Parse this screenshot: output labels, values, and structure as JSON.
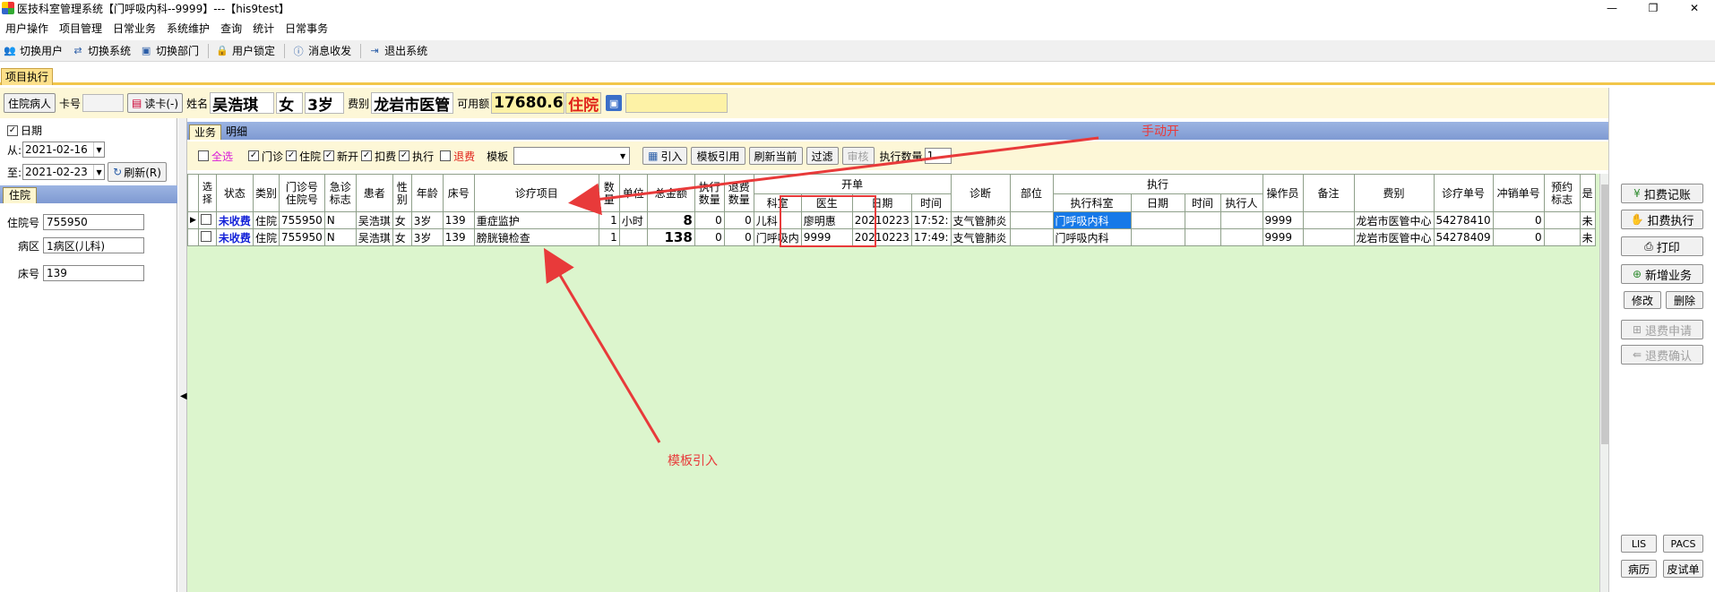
{
  "window": {
    "title": "医技科室管理系统【门呼吸内科--9999】---【his9test】",
    "controls": [
      "—",
      "❐",
      "✕"
    ]
  },
  "menu": [
    "用户操作",
    "项目管理",
    "日常业务",
    "系统维护",
    "查询",
    "统计",
    "日常事务"
  ],
  "toolbar": [
    {
      "icon": "users-icon",
      "label": "切换用户"
    },
    {
      "icon": "switch-system-icon",
      "label": "切换系统"
    },
    {
      "icon": "switch-dept-icon",
      "label": "切换部门"
    },
    {
      "icon": "user-lock-icon",
      "label": "用户锁定"
    },
    {
      "icon": "message-icon",
      "label": "消息收发"
    },
    {
      "icon": "exit-icon",
      "label": "退出系统"
    }
  ],
  "doc_tab": "项目执行",
  "patient_bar": {
    "inpatient_button": "住院病人",
    "card_label": "卡号",
    "card_value": "",
    "read_card_button": "读卡(-)",
    "name_label": "姓名",
    "name": "吴浩琪",
    "gender": "女",
    "age": "3岁",
    "fee_type_label": "费别",
    "fee_type": "龙岩市医管",
    "balance_label": "可用额",
    "balance": "17680.60",
    "visit_type": "住院",
    "extra_value": ""
  },
  "left_panel": {
    "date_label": "日期",
    "date_checked": true,
    "from_label": "从:",
    "from_date": "2021-02-16",
    "to_label": "至:",
    "to_date": "2021-02-23",
    "refresh_button": "刷新(R)",
    "tab": "住院",
    "fields": [
      {
        "label": "住院号",
        "value": "755950"
      },
      {
        "label": "病区",
        "value": "1病区(儿科)"
      },
      {
        "label": "床号",
        "value": "139"
      }
    ]
  },
  "sub_tabs": [
    "业务",
    "明细"
  ],
  "filter_bar": {
    "select_all": "全选",
    "options": [
      {
        "label": "门诊",
        "checked": true
      },
      {
        "label": "住院",
        "checked": true
      },
      {
        "label": "新开",
        "checked": true
      },
      {
        "label": "扣费",
        "checked": true
      },
      {
        "label": "执行",
        "checked": true
      },
      {
        "label": "退费",
        "checked": false
      }
    ],
    "template_label": "模板",
    "template_value": "",
    "buttons": [
      "引入",
      "模板引用",
      "刷新当前",
      "过滤",
      "审核"
    ],
    "exec_count_label": "执行数量",
    "exec_count_value": "1"
  },
  "grid": {
    "group_headers": {
      "kaidan": "开单",
      "zhixing": "执行"
    },
    "headers": {
      "select": "选择",
      "status": "状态",
      "category": "类别",
      "outpatient_no": "门诊号住院号",
      "urgent": "急诊标志",
      "patient": "患者",
      "gender": "性别",
      "age": "年龄",
      "bed": "床号",
      "item": "诊疗项目",
      "qty": "数量",
      "unit": "单位",
      "total": "总金额",
      "exec_qty": "执行数量",
      "refund_qty": "退费数量",
      "order_dept": "科室",
      "order_doctor": "医生",
      "order_date": "日期",
      "order_time": "时间",
      "diagnosis": "诊断",
      "site": "部位",
      "exec_dept": "执行科室",
      "exec_date": "日期",
      "exec_time": "时间",
      "executor": "执行人",
      "operator": "操作员",
      "remark": "备注",
      "fee_type": "费别",
      "bill_no": "诊疗单号",
      "offset_no": "冲销单号",
      "appoint": "预约标志",
      "last": "是"
    },
    "rows": [
      {
        "current": true,
        "status": "未收费",
        "category": "住院",
        "outpatient_no": "755950",
        "urgent": "N",
        "patient": "吴浩琪",
        "gender": "女",
        "age": "3岁",
        "bed": "139",
        "item": "重症监护",
        "qty": "1",
        "unit": "小时",
        "total": "8",
        "exec_qty": "0",
        "refund_qty": "0",
        "order_dept": "儿科",
        "order_doctor": "廖明惠",
        "order_date": "20210223",
        "order_time": "17:52:",
        "diagnosis": "支气管肺炎",
        "site": "",
        "exec_dept": "门呼吸内科",
        "exec_date": "",
        "exec_time": "",
        "executor": "",
        "operator": "9999",
        "remark": "",
        "fee_type": "龙岩市医管中心",
        "bill_no": "54278410",
        "offset_no": "0",
        "appoint": "",
        "last": "未"
      },
      {
        "current": false,
        "status": "未收费",
        "category": "住院",
        "outpatient_no": "755950",
        "urgent": "N",
        "patient": "吴浩琪",
        "gender": "女",
        "age": "3岁",
        "bed": "139",
        "item": "膀胱镜检查",
        "qty": "1",
        "unit": "",
        "total": "138",
        "exec_qty": "0",
        "refund_qty": "0",
        "order_dept": "门呼吸内",
        "order_doctor": "9999",
        "order_date": "20210223",
        "order_time": "17:49:",
        "diagnosis": "支气管肺炎",
        "site": "",
        "exec_dept": "门呼吸内科",
        "exec_date": "",
        "exec_time": "",
        "executor": "",
        "operator": "9999",
        "remark": "",
        "fee_type": "龙岩市医管中心",
        "bill_no": "54278409",
        "offset_no": "0",
        "appoint": "",
        "last": "未"
      }
    ]
  },
  "annotations": {
    "manual": "手动开",
    "template": "模板引入"
  },
  "right_panel": {
    "buttons": {
      "charge_record": "扣费记账",
      "charge_exec": "扣费执行",
      "print": "打印",
      "new_business": "新增业务",
      "modify": "修改",
      "delete": "删除",
      "refund_apply": "退费申请",
      "refund_confirm": "退费确认",
      "lis": "LIS",
      "pacs": "PACS",
      "history": "病历",
      "skin_test": "皮试单"
    }
  },
  "colors": {
    "accent_yellow": "#f2c64a",
    "grid_bg": "#dcf5cd",
    "tab_blue": "#8aa4d8",
    "status_blue": "#1422d8",
    "annotation_red": "#e83a3a",
    "selected_cell": "#1679e8"
  }
}
